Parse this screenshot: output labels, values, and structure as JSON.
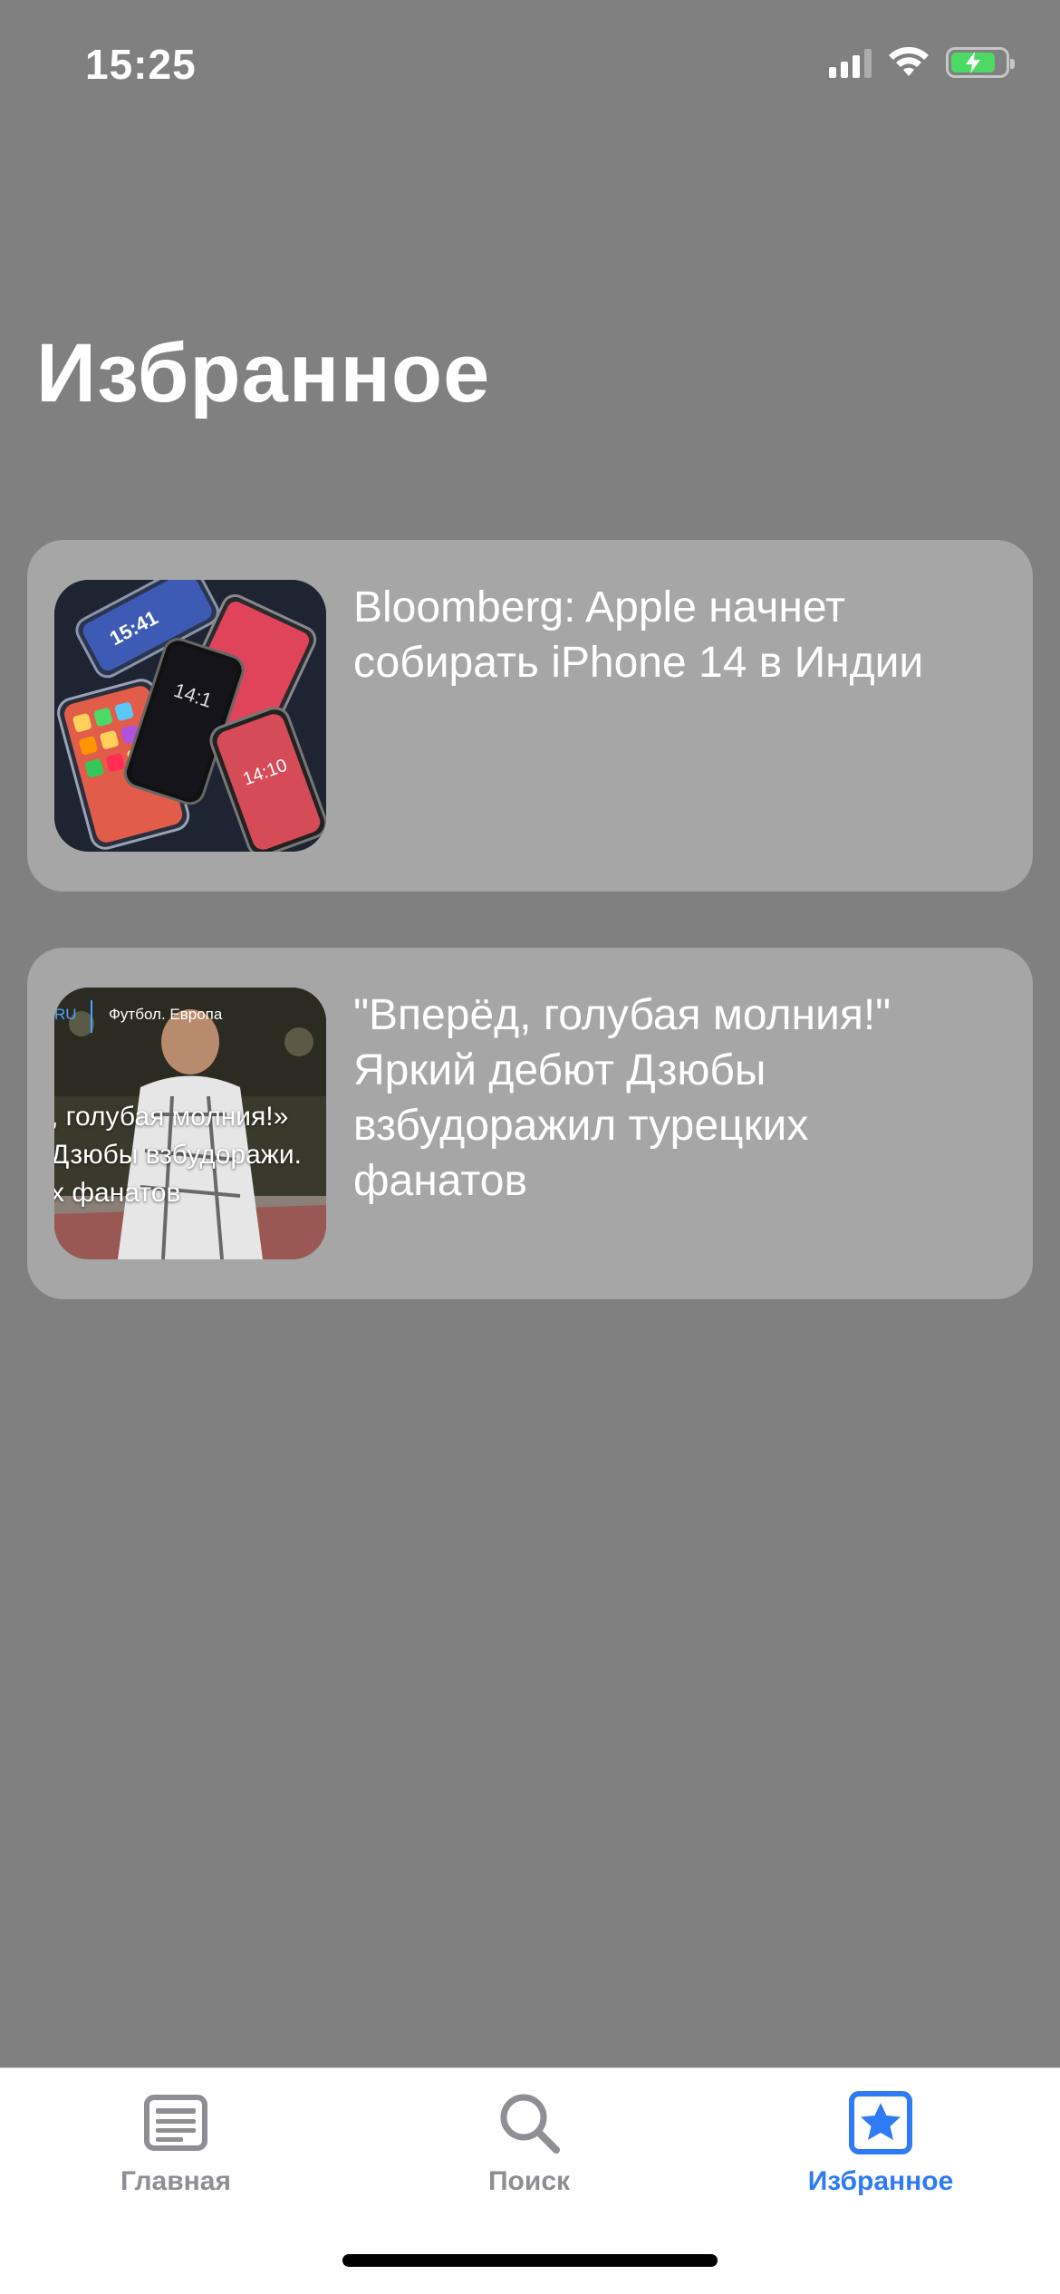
{
  "status_bar": {
    "time": "15:25"
  },
  "page": {
    "title": "Избранное"
  },
  "favorites": [
    {
      "title": "Bloomberg: Apple начнет собирать iPhone 14 в Индии",
      "thumbnail": "iphone-lockscreens-image"
    },
    {
      "title": "\"Вперёд, голубая молния!\" Яркий дебют Дзюбы взбудоражил турецких фанатов",
      "thumbnail": "football-player-image",
      "thumb_tag": "Футбол. Европа",
      "thumb_prefix": "RU",
      "thumb_caption_1": ", голубая молния!»",
      "thumb_caption_2": "Дзюбы взбудоражи.",
      "thumb_caption_3": "х фанатов"
    }
  ],
  "tabbar": {
    "items": [
      {
        "label": "Главная",
        "icon": "newspaper-icon",
        "active": false
      },
      {
        "label": "Поиск",
        "icon": "search-icon",
        "active": false
      },
      {
        "label": "Избранное",
        "icon": "star-icon",
        "active": true
      }
    ],
    "active_color": "#2f7bf5",
    "inactive_color": "#8e8e93"
  }
}
